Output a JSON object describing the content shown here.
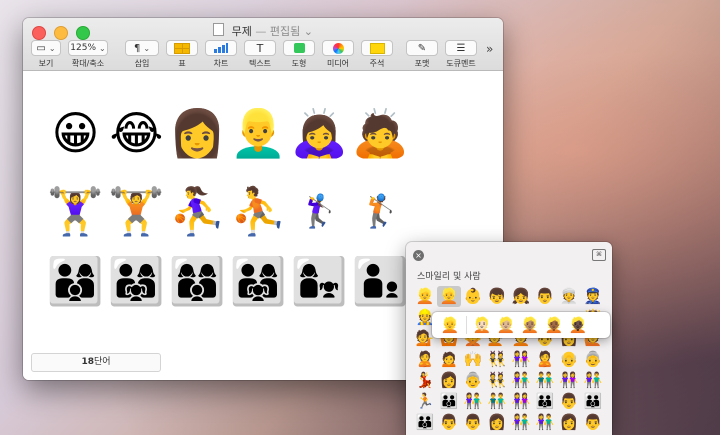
{
  "window": {
    "title": "무제",
    "separator": "—",
    "status": "편집됨",
    "status_chevron": "⌄"
  },
  "toolbar": {
    "items": [
      {
        "id": "view",
        "label": "보기",
        "icon": "▭",
        "chevron": "⌄",
        "icon_name": "view-icon"
      },
      {
        "id": "zoom",
        "label": "확대/축소",
        "icon": "125%",
        "chevron": "⌄",
        "icon_name": "zoom-value"
      },
      {
        "id": "insert",
        "label": "삽입",
        "icon": "¶",
        "chevron": "⌄",
        "icon_name": "pilcrow-icon"
      },
      {
        "id": "table",
        "label": "표",
        "icon": "",
        "icon_name": "table-icon"
      },
      {
        "id": "chart",
        "label": "차트",
        "icon": "",
        "icon_name": "chart-icon"
      },
      {
        "id": "text",
        "label": "텍스트",
        "icon": "T",
        "icon_name": "text-icon"
      },
      {
        "id": "shape",
        "label": "도형",
        "icon": "",
        "icon_name": "shape-icon"
      },
      {
        "id": "media",
        "label": "미디어",
        "icon": "",
        "icon_name": "media-icon"
      },
      {
        "id": "comment",
        "label": "주석",
        "icon": "",
        "icon_name": "comment-icon"
      },
      {
        "id": "format",
        "label": "포맷",
        "icon": "✎",
        "icon_name": "format-brush-icon"
      },
      {
        "id": "document",
        "label": "도큐멘트",
        "icon": "☰",
        "icon_name": "document-icon"
      }
    ],
    "more": "»"
  },
  "document_emoji": {
    "row1": [
      "😀",
      "😂",
      "👩",
      "👱‍♂️",
      "🙇‍♀️",
      "🙇"
    ],
    "row2": [
      "🏋️‍♀️",
      "🏋️",
      "⛹️‍♀️",
      "⛹️",
      "🏌️‍♀️",
      "🏌️"
    ],
    "row3_families": [
      "👨‍👩‍👦",
      "👨‍👩‍👧",
      "👩‍👩‍👦",
      "👨‍👩‍👧"
    ],
    "row3_singles": [
      "👩‍👧",
      "👨‍👦"
    ]
  },
  "word_count": {
    "number": "18",
    "unit": "단어"
  },
  "picker": {
    "close": "×",
    "expand": "⌘",
    "category": "스마일리 및 사람",
    "rows": [
      [
        "👱",
        "👱",
        "👶",
        "👦",
        "👧",
        "👨",
        "👳",
        "👮"
      ],
      [
        "👷",
        "",
        "",
        "",
        "",
        "",
        "",
        "👸"
      ],
      [
        "💁",
        "🙆",
        "🙅",
        "💇",
        "💆",
        "👨",
        "👩",
        "🙋"
      ],
      [
        "🙎",
        "🙍",
        "🙌",
        "👯",
        "👭",
        "🙎",
        "👴",
        "👵"
      ],
      [
        "💃",
        "👩",
        "👵",
        "👯",
        "👫",
        "👬",
        "👭",
        "👫"
      ],
      [
        "🏃",
        "👪",
        "👫",
        "👬",
        "👭",
        "👪",
        "👨",
        "👪"
      ],
      [
        "👪",
        "👨",
        "👨",
        "👩",
        "👫",
        "👫",
        "👩",
        "👨"
      ]
    ],
    "selected_index": 1
  },
  "skin_tones": [
    "👱",
    "👱🏻",
    "👱🏼",
    "👱🏽",
    "👱🏾",
    "👱🏿"
  ]
}
